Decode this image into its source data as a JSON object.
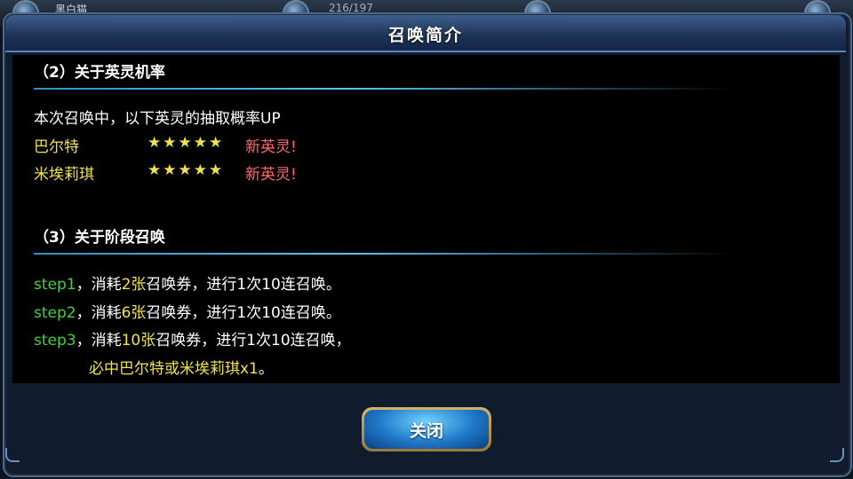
{
  "background": {
    "player_name": "黑白猫",
    "counter": "216/197"
  },
  "dialog": {
    "title": "召唤简介",
    "section2": {
      "title": "（2）关于英灵机率",
      "intro": "本次召唤中，以下英灵的抽取概率UP",
      "heroes": [
        {
          "name": "巴尔特",
          "stars": "★★★★★",
          "badge": "新英灵!"
        },
        {
          "name": "米埃莉琪",
          "stars": "★★★★★",
          "badge": "新英灵!"
        }
      ]
    },
    "section3": {
      "title": "（3）关于阶段召唤",
      "steps": [
        {
          "label": "step1",
          "pre": "，消耗",
          "count": "2张",
          "post": "召唤券，进行1次10连召唤。"
        },
        {
          "label": "step2",
          "pre": "，消耗",
          "count": "6张",
          "post": "召唤券，进行1次10连召唤。"
        },
        {
          "label": "step3",
          "pre": "，消耗",
          "count": "10张",
          "post": "召唤券，进行1次10连召唤，"
        }
      ],
      "guarantee": "必中巴尔特或米埃莉琪x1",
      "guarantee_end": "。"
    },
    "close_label": "关闭"
  },
  "colors": {
    "highlight_yellow": "#f2e24a",
    "step_green": "#3fd23f",
    "badge_red": "#ff6a6a",
    "header_blue": "#1f3558",
    "button_blue": "#1f78c8"
  }
}
